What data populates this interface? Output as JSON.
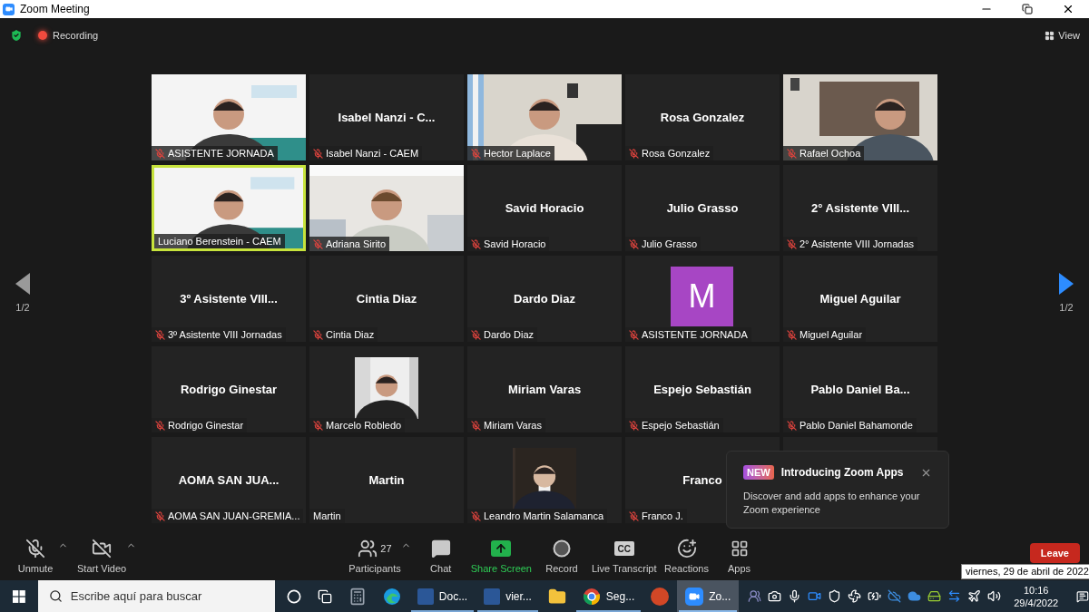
{
  "window": {
    "title": "Zoom Meeting"
  },
  "top_bar": {
    "recording": "Recording",
    "view": "View"
  },
  "pager": [
    {
      "label": "1/2",
      "disabled": true
    },
    {
      "label": "1/2",
      "disabled": false
    }
  ],
  "tiles": [
    {
      "kind": "video",
      "label": "ASISTENTE JORNADA",
      "muted": true,
      "speaking": false
    },
    {
      "kind": "name",
      "name": "Isabel Nanzi - C...",
      "label": "Isabel Nanzi - CAEM",
      "muted": true,
      "speaking": false
    },
    {
      "kind": "video",
      "label": "Hector Laplace",
      "muted": true,
      "speaking": false
    },
    {
      "kind": "name",
      "name": "Rosa Gonzalez",
      "label": "Rosa Gonzalez",
      "muted": true,
      "speaking": false
    },
    {
      "kind": "video",
      "label": "Rafael Ochoa",
      "muted": true,
      "speaking": false
    },
    {
      "kind": "video",
      "label": "Luciano Berenstein - CAEM",
      "muted": false,
      "speaking": true
    },
    {
      "kind": "video",
      "label": "Adriana Sirito",
      "muted": true,
      "speaking": false
    },
    {
      "kind": "name",
      "name": "Savid Horacio",
      "label": "Savid Horacio",
      "muted": true,
      "speaking": false
    },
    {
      "kind": "name",
      "name": "Julio Grasso",
      "label": "Julio Grasso",
      "muted": true,
      "speaking": false
    },
    {
      "kind": "name",
      "name": "2° Asistente VIII...",
      "label": "2° Asistente VIII Jornadas",
      "muted": true,
      "speaking": false
    },
    {
      "kind": "name",
      "name": "3º Asistente VIII...",
      "label": "3º Asistente VIII Jornadas",
      "muted": true,
      "speaking": false
    },
    {
      "kind": "name",
      "name": "Cintia Diaz",
      "label": "Cintia Diaz",
      "muted": true,
      "speaking": false
    },
    {
      "kind": "name",
      "name": "Dardo Diaz",
      "label": "Dardo Diaz",
      "muted": true,
      "speaking": false
    },
    {
      "kind": "avatar",
      "initial": "M",
      "label": "ASISTENTE JORNADA",
      "muted": true,
      "speaking": false
    },
    {
      "kind": "name",
      "name": "Miguel Aguilar",
      "label": "Miguel Aguilar",
      "muted": true,
      "speaking": false
    },
    {
      "kind": "name",
      "name": "Rodrigo Ginestar",
      "label": "Rodrigo Ginestar",
      "muted": true,
      "speaking": false
    },
    {
      "label": "Marcelo Robledo",
      "muted": true,
      "speaking": false
    },
    {
      "kind": "name",
      "name": "Miriam Varas",
      "label": "Miriam Varas",
      "muted": true,
      "speaking": false
    },
    {
      "kind": "name",
      "name": "Espejo Sebastián",
      "label": "Espejo Sebastián",
      "muted": true,
      "speaking": false
    },
    {
      "kind": "name",
      "name": "Pablo Daniel Ba...",
      "label": "Pablo Daniel Bahamonde",
      "muted": true,
      "speaking": false
    },
    {
      "kind": "name",
      "name": "AOMA SAN JUA...",
      "label": "AOMA SAN JUAN-GREMIA...",
      "muted": true,
      "speaking": false
    },
    {
      "kind": "name",
      "name": "Martin",
      "label": "Martin",
      "muted": false,
      "speaking": false
    },
    {
      "label": "Leandro Martin Salamanca",
      "muted": true,
      "speaking": false
    },
    {
      "kind": "name",
      "name": "Franco",
      "label": "Franco J.",
      "muted": true,
      "speaking": false
    },
    {
      "kind": "blank"
    }
  ],
  "popup": {
    "badge": "NEW",
    "title": "Introducing Zoom Apps",
    "body": "Discover and add apps to enhance your Zoom experience"
  },
  "toolbar": [
    {
      "kind": "mic",
      "label": "Unmute",
      "caret": true
    },
    {
      "kind": "camera",
      "label": "Start Video",
      "caret": true
    },
    {
      "kind": "participants",
      "label": "Participants",
      "count": "27",
      "caret": true
    },
    {
      "kind": "chat",
      "label": "Chat",
      "caret": false
    },
    {
      "kind": "share",
      "label": "Share Screen",
      "caret": false
    },
    {
      "kind": "record",
      "label": "Record",
      "caret": false
    },
    {
      "kind": "transcript",
      "label": "Live Transcript",
      "badge": "CC",
      "caret": false
    },
    {
      "kind": "reactions",
      "label": "Reactions",
      "caret": false
    },
    {
      "kind": "apps",
      "label": "Apps",
      "caret": false
    }
  ],
  "leave": "Leave",
  "tooltip": "viernes, 29 de abril de 2022",
  "taskbar": {
    "search": {
      "placeholder": "Escribe aquí para buscar"
    },
    "apps": [
      {
        "kind": "cortana",
        "open": false,
        "selected": false
      },
      {
        "kind": "taskview",
        "open": false,
        "selected": false
      },
      {
        "kind": "calculator",
        "open": false,
        "selected": false
      },
      {
        "kind": "edge",
        "open": false,
        "selected": false
      },
      {
        "kind": "word",
        "label": "Doc...",
        "open": true,
        "selected": false
      },
      {
        "kind": "word",
        "label": "vier...",
        "open": true,
        "selected": false
      },
      {
        "kind": "explorer",
        "open": false,
        "selected": false
      },
      {
        "kind": "chrome",
        "label": "Seg...",
        "open": true,
        "selected": false
      },
      {
        "kind": "powerpoint",
        "open": false,
        "selected": false
      },
      {
        "kind": "zoom",
        "label": "Zo...",
        "open": true,
        "selected": true
      }
    ],
    "time": "10:16",
    "date": "29/4/2022"
  }
}
